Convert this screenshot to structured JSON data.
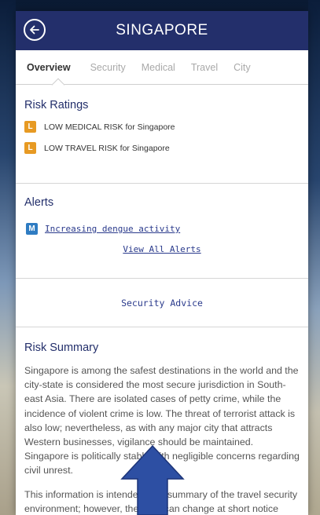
{
  "header": {
    "title": "SINGAPORE"
  },
  "tabs": [
    {
      "label": "Overview"
    },
    {
      "label": "Security"
    },
    {
      "label": "Medical"
    },
    {
      "label": "Travel"
    },
    {
      "label": "City"
    }
  ],
  "risk_ratings": {
    "title": "Risk Ratings",
    "items": [
      {
        "badge": "L",
        "text": "LOW MEDICAL RISK for Singapore"
      },
      {
        "badge": "L",
        "text": "LOW TRAVEL RISK for Singapore"
      }
    ],
    "badge_color": "#e79a23"
  },
  "alerts": {
    "title": "Alerts",
    "items": [
      {
        "badge": "M",
        "text": "Increasing dengue activity"
      }
    ],
    "view_all": "View All Alerts",
    "badge_color": "#2f7cc2"
  },
  "security_advice": "Security Advice",
  "risk_summary": {
    "title": "Risk Summary",
    "paragraph1": "Singapore is among the safest destinations in the world and the city-state is considered the most secure jurisdiction in South-east Asia. There are isolated cases of petty crime, while the incidence of violent crime is low. The threat of terrorist attack is also low; nevertheless, as with any major city that attracts Western businesses, vigilance should be maintained. Singapore is politically stable with negligible concerns regarding civil unrest.",
    "paragraph2": "This information is intended as a summary of the travel security environment; however, the risks can change at short notice during a crisis or evolving situation. Please"
  },
  "colors": {
    "header_bg": "#232f6b",
    "link": "#2a3a8c",
    "arrow": "#2d4fa3"
  },
  "icons": {
    "back": "back-arrow-circle-icon",
    "scroll": "scroll-up-arrow-icon"
  }
}
